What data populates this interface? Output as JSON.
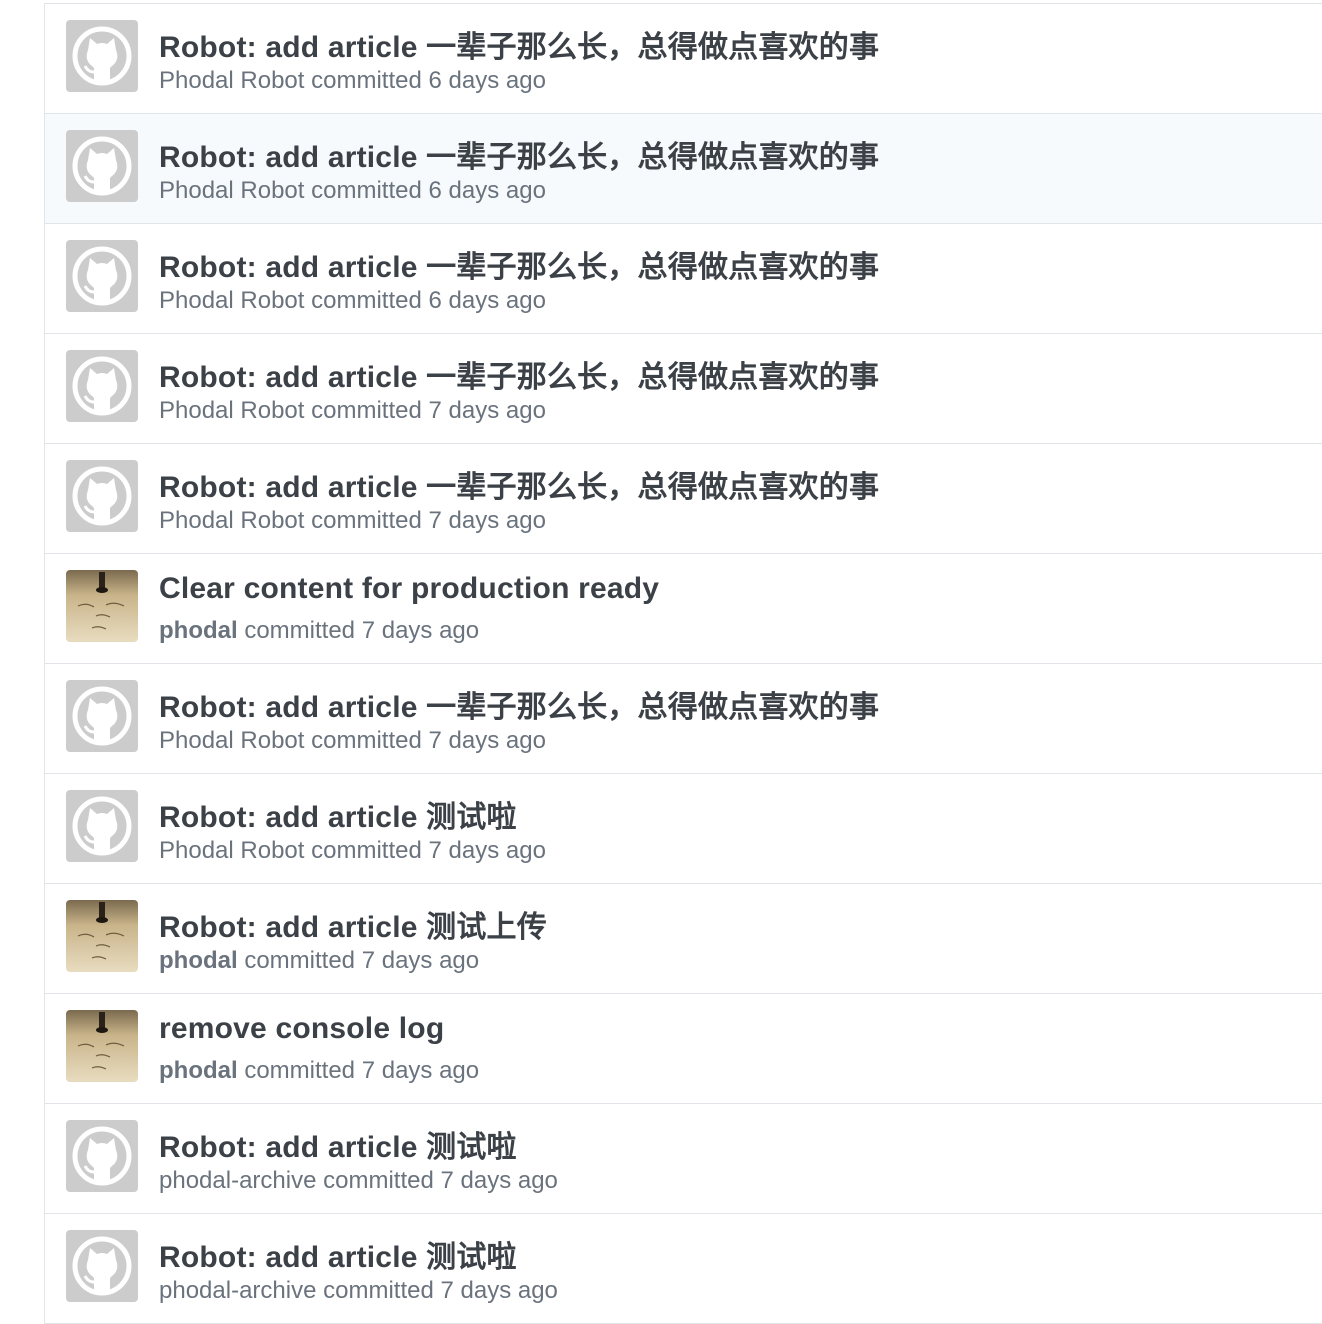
{
  "commits": [
    {
      "title": "Robot: add article 一辈子那么长，总得做点喜欢的事",
      "author": "Phodal Robot",
      "verb": "committed",
      "time": "6 days ago",
      "avatar": "octocat-icon",
      "highlight": false
    },
    {
      "title": "Robot: add article 一辈子那么长，总得做点喜欢的事",
      "author": "Phodal Robot",
      "verb": "committed",
      "time": "6 days ago",
      "avatar": "octocat-icon",
      "highlight": true
    },
    {
      "title": "Robot: add article 一辈子那么长，总得做点喜欢的事",
      "author": "Phodal Robot",
      "verb": "committed",
      "time": "6 days ago",
      "avatar": "octocat-icon",
      "highlight": false
    },
    {
      "title": "Robot: add article 一辈子那么长，总得做点喜欢的事",
      "author": "Phodal Robot",
      "verb": "committed",
      "time": "7 days ago",
      "avatar": "octocat-icon",
      "highlight": false
    },
    {
      "title": "Robot: add article 一辈子那么长，总得做点喜欢的事",
      "author": "Phodal Robot",
      "verb": "committed",
      "time": "7 days ago",
      "avatar": "octocat-icon",
      "highlight": false
    },
    {
      "title": "Clear content for production ready",
      "author": "phodal",
      "verb": "committed",
      "time": "7 days ago",
      "avatar": "user-photo",
      "highlight": false
    },
    {
      "title": "Robot: add article 一辈子那么长，总得做点喜欢的事",
      "author": "Phodal Robot",
      "verb": "committed",
      "time": "7 days ago",
      "avatar": "octocat-icon",
      "highlight": false
    },
    {
      "title": "Robot: add article 测试啦",
      "author": "Phodal Robot",
      "verb": "committed",
      "time": "7 days ago",
      "avatar": "octocat-icon",
      "highlight": false
    },
    {
      "title": "Robot: add article 测试上传",
      "author": "phodal",
      "verb": "committed",
      "time": "7 days ago",
      "avatar": "user-photo",
      "highlight": false
    },
    {
      "title": "remove console log",
      "author": "phodal",
      "verb": "committed",
      "time": "7 days ago",
      "avatar": "user-photo",
      "highlight": false
    },
    {
      "title": "Robot: add article 测试啦",
      "author": "phodal-archive",
      "verb": "committed",
      "time": "7 days ago",
      "avatar": "octocat-icon",
      "highlight": false
    },
    {
      "title": "Robot: add article 测试啦",
      "author": "phodal-archive",
      "verb": "committed",
      "time": "7 days ago",
      "avatar": "octocat-icon",
      "highlight": false
    }
  ],
  "colors": {
    "title": "#3b4147",
    "meta": "#6a737d",
    "border": "#e1e4e8",
    "highlight_row": "#f6fafc",
    "octocat_bg": "#cccccc"
  }
}
